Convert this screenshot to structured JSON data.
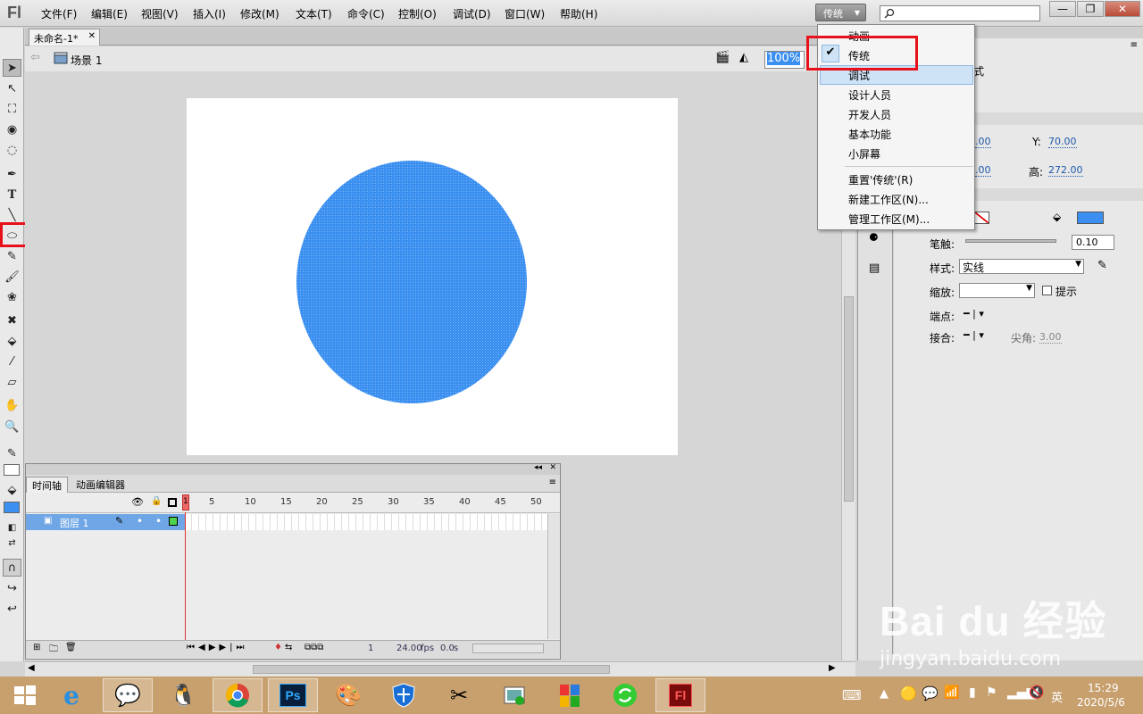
{
  "app": {
    "logo": "Fl"
  },
  "menu": [
    "文件(F)",
    "编辑(E)",
    "视图(V)",
    "插入(I)",
    "修改(M)",
    "文本(T)",
    "命令(C)",
    "控制(O)",
    "调试(D)",
    "窗口(W)",
    "帮助(H)"
  ],
  "workspace": {
    "current": "传统",
    "options": [
      "动画",
      "传统",
      "调试",
      "设计人员",
      "开发人员",
      "基本功能",
      "小屏幕"
    ],
    "actions": [
      "重置'传统'(R)",
      "新建工作区(N)...",
      "管理工作区(M)..."
    ],
    "checked": "传统",
    "highlighted": "调试"
  },
  "window_controls": [
    "—",
    "❐",
    "✕"
  ],
  "document": {
    "tab": "未命名-1*",
    "scene": "场景 1",
    "zoom": "100%"
  },
  "stage": {
    "shape_color": "#3a8ff0"
  },
  "timeline": {
    "tabs": [
      "时间轴",
      "动画编辑器"
    ],
    "layer": "图层 1",
    "frame_numbers": [
      "1",
      "5",
      "10",
      "15",
      "20",
      "25",
      "30",
      "35",
      "40",
      "45",
      "50"
    ],
    "current_frame": "1",
    "fps": "24.00",
    "fps_unit": "fps",
    "time": "0.0",
    "time_unit": "s"
  },
  "properties": {
    "partial_label": "式",
    "x_value": ".00",
    "y_label": "Y:",
    "y_value": "70.00",
    "w_value": ".00",
    "h_label": "高:",
    "h_value": "272.00",
    "stroke_label": "笔触:",
    "stroke_value": "0.10",
    "style_label": "样式:",
    "style_value": "实线",
    "scale_label": "缩放:",
    "hint_label": "提示",
    "cap_label": "端点:",
    "join_label": "接合:",
    "miter_label": "尖角:",
    "miter_value": "3.00",
    "fill_color": "#3a8ff0"
  },
  "taskbar": {
    "time": "15:29",
    "date": "2020/5/6",
    "lang": "英"
  },
  "watermark": {
    "logo": "Bai du 经验",
    "url": "jingyan.baidu.com"
  }
}
